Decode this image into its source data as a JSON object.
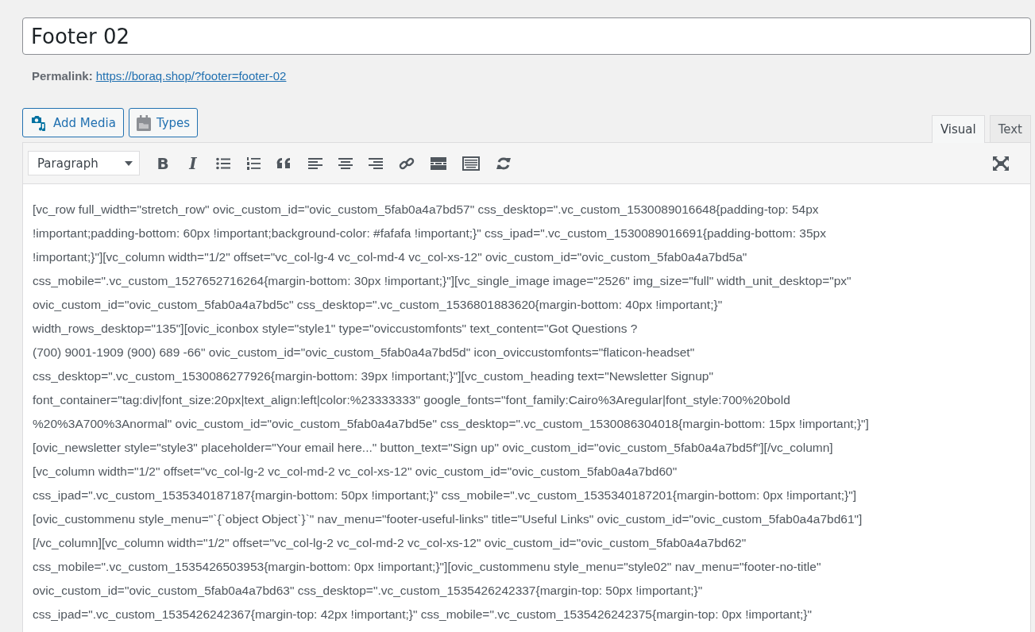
{
  "title_field": {
    "value": "Footer 02"
  },
  "permalink": {
    "label": "Permalink:",
    "url": "https://boraq.shop/?footer=footer-02"
  },
  "media_buttons": [
    {
      "label": "Add Media",
      "kind": "media"
    },
    {
      "label": "Types",
      "kind": "types"
    }
  ],
  "tabs": [
    {
      "label": "Visual",
      "selected": true
    },
    {
      "label": "Text",
      "selected": false
    }
  ],
  "toolbar": {
    "format": "Paragraph",
    "bold_label": "B",
    "italic_label": "I"
  },
  "content_lines": [
    "[vc_row full_width=\"stretch_row\" ovic_custom_id=\"ovic_custom_5fab0a4a7bd57\" css_desktop=\".vc_custom_1530089016648{padding-top: 54px",
    "!important;padding-bottom: 60px !important;background-color: #fafafa !important;}\" css_ipad=\".vc_custom_1530089016691{padding-bottom: 35px",
    "!important;}\"][vc_column width=\"1/2\" offset=\"vc_col-lg-4 vc_col-md-4 vc_col-xs-12\" ovic_custom_id=\"ovic_custom_5fab0a4a7bd5a\"",
    "css_mobile=\".vc_custom_1527652716264{margin-bottom: 30px !important;}\"][vc_single_image image=\"2526\" img_size=\"full\" width_unit_desktop=\"px\"",
    "ovic_custom_id=\"ovic_custom_5fab0a4a7bd5c\" css_desktop=\".vc_custom_1536801883620{margin-bottom: 40px !important;}\"",
    "width_rows_desktop=\"135\"][ovic_iconbox style=\"style1\" type=\"oviccustomfonts\" text_content=\"Got Questions ?",
    "(700) 9001-1909 (900) 689 -66\" ovic_custom_id=\"ovic_custom_5fab0a4a7bd5d\" icon_oviccustomfonts=\"flaticon-headset\"",
    "css_desktop=\".vc_custom_1530086277926{margin-bottom: 39px !important;}\"][vc_custom_heading text=\"Newsletter Signup\"",
    "font_container=\"tag:div|font_size:20px|text_align:left|color:%23333333\" google_fonts=\"font_family:Cairo%3Aregular|font_style:700%20bold",
    "%20%3A700%3Anormal\" ovic_custom_id=\"ovic_custom_5fab0a4a7bd5e\" css_desktop=\".vc_custom_1530086304018{margin-bottom: 15px !important;}\"]",
    "[ovic_newsletter style=\"style3\" placeholder=\"Your email here...\" button_text=\"Sign up\" ovic_custom_id=\"ovic_custom_5fab0a4a7bd5f\"][/vc_column]",
    "[vc_column width=\"1/2\" offset=\"vc_col-lg-2 vc_col-md-2 vc_col-xs-12\" ovic_custom_id=\"ovic_custom_5fab0a4a7bd60\"",
    "css_ipad=\".vc_custom_1535340187187{margin-bottom: 50px !important;}\" css_mobile=\".vc_custom_1535340187201{margin-bottom: 0px !important;}\"]",
    "[ovic_custommenu style_menu=\"`{`object Object`}`\" nav_menu=\"footer-useful-links\" title=\"Useful Links\" ovic_custom_id=\"ovic_custom_5fab0a4a7bd61\"]",
    "[/vc_column][vc_column width=\"1/2\" offset=\"vc_col-lg-2 vc_col-md-2 vc_col-xs-12\" ovic_custom_id=\"ovic_custom_5fab0a4a7bd62\"",
    "css_mobile=\".vc_custom_1535426503953{margin-bottom: 0px !important;}\"][ovic_custommenu style_menu=\"style02\" nav_menu=\"footer-no-title\"",
    "ovic_custom_id=\"ovic_custom_5fab0a4a7bd63\" css_desktop=\".vc_custom_1535426242337{margin-top: 50px !important;}\"",
    "css_ipad=\".vc_custom_1535426242367{margin-top: 42px !important;}\" css_mobile=\".vc_custom_1535426242375{margin-top: 0px !important;}\""
  ]
}
